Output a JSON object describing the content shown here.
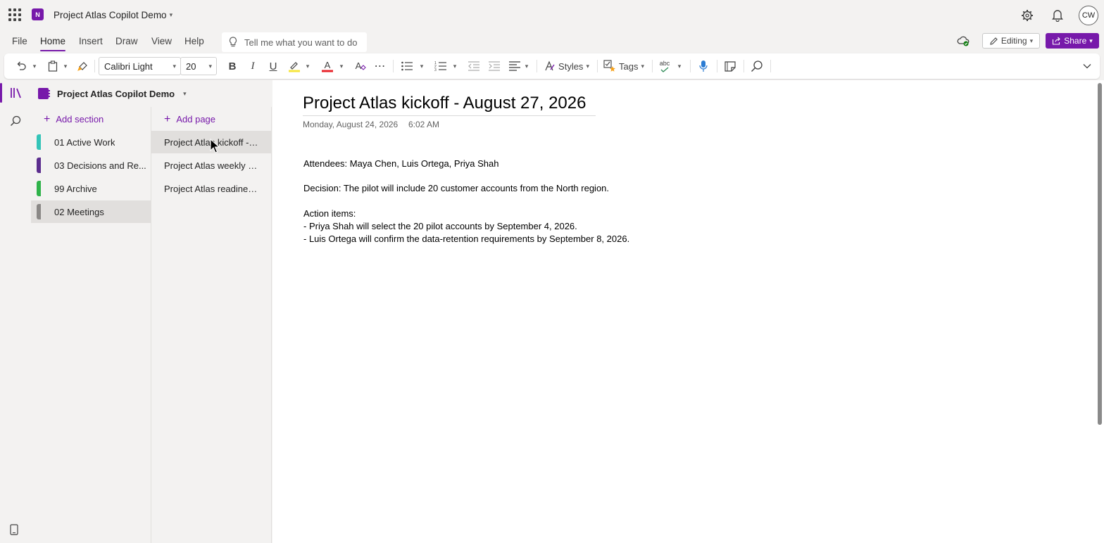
{
  "titlebar": {
    "notebook_title": "Project Atlas Copilot Demo",
    "avatar_initials": "CW"
  },
  "menu": {
    "items": [
      "File",
      "Home",
      "Insert",
      "Draw",
      "View",
      "Help"
    ],
    "active": "Home",
    "tellme_placeholder": "Tell me what you want to do",
    "editing_label": "Editing",
    "share_label": "Share"
  },
  "ribbon": {
    "font_name": "Calibri Light",
    "font_size": "20",
    "bold": "B",
    "italic": "I",
    "underline": "U",
    "styles_label": "Styles",
    "tags_label": "Tags",
    "spell_label": "abc"
  },
  "notebook": {
    "name": "Project Atlas Copilot Demo",
    "add_section_label": "Add section",
    "add_page_label": "Add page",
    "sections": [
      {
        "label": "01 Active Work",
        "color": "#33c4b8"
      },
      {
        "label": "03 Decisions and Re...",
        "color": "#5b2d8e"
      },
      {
        "label": "99 Archive",
        "color": "#2fb34a"
      },
      {
        "label": "02 Meetings",
        "color": "#8a8886"
      }
    ],
    "selected_section": "02 Meetings",
    "pages": [
      {
        "label": "Project Atlas kickoff - A..."
      },
      {
        "label": "Project Atlas weekly sy..."
      },
      {
        "label": "Project Atlas readiness ..."
      }
    ],
    "selected_page": "Project Atlas kickoff - A..."
  },
  "page": {
    "title": "Project Atlas kickoff - August 27, 2026",
    "date": "Monday, August 24, 2026",
    "time": "6:02 AM",
    "lines": [
      "Attendees: Maya Chen, Luis Ortega, Priya Shah",
      "Decision: The pilot will include 20 customer accounts from the North region.",
      "Action items:",
      "- Priya Shah will select the 20 pilot accounts by September 4, 2026.",
      "- Luis Ortega will confirm the data-retention requirements by September 8, 2026."
    ]
  },
  "colors": {
    "accent": "#7719aa",
    "highlight_bar": "#f7e63c",
    "font_color_bar": "#e8242b"
  }
}
